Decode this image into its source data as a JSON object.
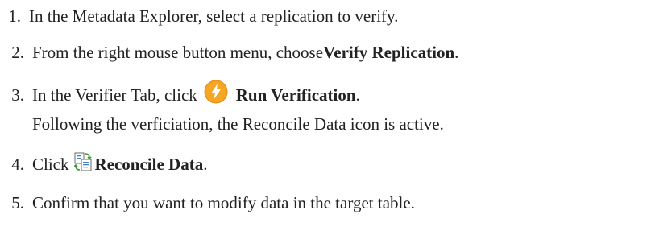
{
  "steps": [
    {
      "number": "1.",
      "text": "In the Metadata Explorer, select a replication to verify."
    },
    {
      "number": "2.",
      "text_before": "From the right mouse button menu, choose ",
      "bold": "Verify Replication",
      "text_after": "."
    },
    {
      "number": "3.",
      "text_before": "In the Verifier Tab, click",
      "icon": "run-verification-bolt-icon",
      "bold": "Run Verification",
      "text_after": ".",
      "note": "Following the verficiation, the Reconcile Data icon is active."
    },
    {
      "number": "4.",
      "text_before": "Click",
      "icon": "reconcile-data-icon",
      "bold": "Reconcile Data",
      "text_after": "."
    },
    {
      "number": "5.",
      "text": "Confirm that you want to modify data in the target table."
    }
  ],
  "colors": {
    "text": "#222222",
    "bolt_orange": "#f5a623",
    "bolt_white": "#ffffff",
    "reconcile_green": "#3a9a3a",
    "reconcile_blue": "#4a7fc0"
  }
}
